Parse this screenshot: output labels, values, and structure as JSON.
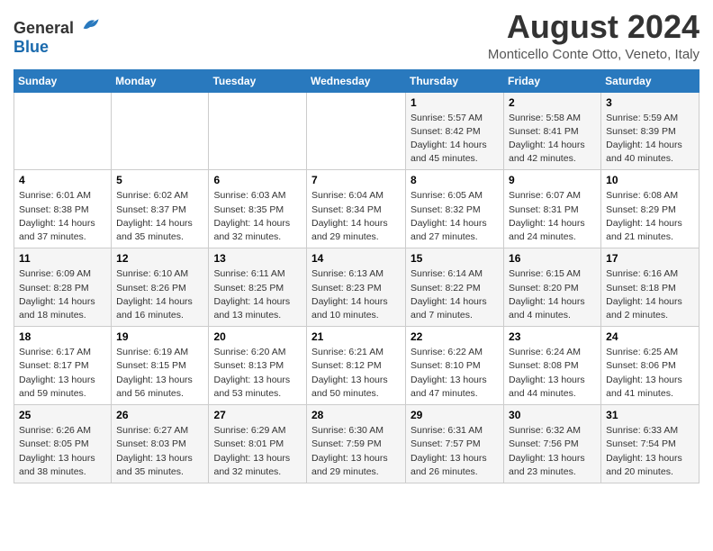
{
  "header": {
    "logo_general": "General",
    "logo_blue": "Blue",
    "month_title": "August 2024",
    "subtitle": "Monticello Conte Otto, Veneto, Italy"
  },
  "days_of_week": [
    "Sunday",
    "Monday",
    "Tuesday",
    "Wednesday",
    "Thursday",
    "Friday",
    "Saturday"
  ],
  "weeks": [
    [
      {
        "day": "",
        "info": ""
      },
      {
        "day": "",
        "info": ""
      },
      {
        "day": "",
        "info": ""
      },
      {
        "day": "",
        "info": ""
      },
      {
        "day": "1",
        "info": "Sunrise: 5:57 AM\nSunset: 8:42 PM\nDaylight: 14 hours\nand 45 minutes."
      },
      {
        "day": "2",
        "info": "Sunrise: 5:58 AM\nSunset: 8:41 PM\nDaylight: 14 hours\nand 42 minutes."
      },
      {
        "day": "3",
        "info": "Sunrise: 5:59 AM\nSunset: 8:39 PM\nDaylight: 14 hours\nand 40 minutes."
      }
    ],
    [
      {
        "day": "4",
        "info": "Sunrise: 6:01 AM\nSunset: 8:38 PM\nDaylight: 14 hours\nand 37 minutes."
      },
      {
        "day": "5",
        "info": "Sunrise: 6:02 AM\nSunset: 8:37 PM\nDaylight: 14 hours\nand 35 minutes."
      },
      {
        "day": "6",
        "info": "Sunrise: 6:03 AM\nSunset: 8:35 PM\nDaylight: 14 hours\nand 32 minutes."
      },
      {
        "day": "7",
        "info": "Sunrise: 6:04 AM\nSunset: 8:34 PM\nDaylight: 14 hours\nand 29 minutes."
      },
      {
        "day": "8",
        "info": "Sunrise: 6:05 AM\nSunset: 8:32 PM\nDaylight: 14 hours\nand 27 minutes."
      },
      {
        "day": "9",
        "info": "Sunrise: 6:07 AM\nSunset: 8:31 PM\nDaylight: 14 hours\nand 24 minutes."
      },
      {
        "day": "10",
        "info": "Sunrise: 6:08 AM\nSunset: 8:29 PM\nDaylight: 14 hours\nand 21 minutes."
      }
    ],
    [
      {
        "day": "11",
        "info": "Sunrise: 6:09 AM\nSunset: 8:28 PM\nDaylight: 14 hours\nand 18 minutes."
      },
      {
        "day": "12",
        "info": "Sunrise: 6:10 AM\nSunset: 8:26 PM\nDaylight: 14 hours\nand 16 minutes."
      },
      {
        "day": "13",
        "info": "Sunrise: 6:11 AM\nSunset: 8:25 PM\nDaylight: 14 hours\nand 13 minutes."
      },
      {
        "day": "14",
        "info": "Sunrise: 6:13 AM\nSunset: 8:23 PM\nDaylight: 14 hours\nand 10 minutes."
      },
      {
        "day": "15",
        "info": "Sunrise: 6:14 AM\nSunset: 8:22 PM\nDaylight: 14 hours\nand 7 minutes."
      },
      {
        "day": "16",
        "info": "Sunrise: 6:15 AM\nSunset: 8:20 PM\nDaylight: 14 hours\nand 4 minutes."
      },
      {
        "day": "17",
        "info": "Sunrise: 6:16 AM\nSunset: 8:18 PM\nDaylight: 14 hours\nand 2 minutes."
      }
    ],
    [
      {
        "day": "18",
        "info": "Sunrise: 6:17 AM\nSunset: 8:17 PM\nDaylight: 13 hours\nand 59 minutes."
      },
      {
        "day": "19",
        "info": "Sunrise: 6:19 AM\nSunset: 8:15 PM\nDaylight: 13 hours\nand 56 minutes."
      },
      {
        "day": "20",
        "info": "Sunrise: 6:20 AM\nSunset: 8:13 PM\nDaylight: 13 hours\nand 53 minutes."
      },
      {
        "day": "21",
        "info": "Sunrise: 6:21 AM\nSunset: 8:12 PM\nDaylight: 13 hours\nand 50 minutes."
      },
      {
        "day": "22",
        "info": "Sunrise: 6:22 AM\nSunset: 8:10 PM\nDaylight: 13 hours\nand 47 minutes."
      },
      {
        "day": "23",
        "info": "Sunrise: 6:24 AM\nSunset: 8:08 PM\nDaylight: 13 hours\nand 44 minutes."
      },
      {
        "day": "24",
        "info": "Sunrise: 6:25 AM\nSunset: 8:06 PM\nDaylight: 13 hours\nand 41 minutes."
      }
    ],
    [
      {
        "day": "25",
        "info": "Sunrise: 6:26 AM\nSunset: 8:05 PM\nDaylight: 13 hours\nand 38 minutes."
      },
      {
        "day": "26",
        "info": "Sunrise: 6:27 AM\nSunset: 8:03 PM\nDaylight: 13 hours\nand 35 minutes."
      },
      {
        "day": "27",
        "info": "Sunrise: 6:29 AM\nSunset: 8:01 PM\nDaylight: 13 hours\nand 32 minutes."
      },
      {
        "day": "28",
        "info": "Sunrise: 6:30 AM\nSunset: 7:59 PM\nDaylight: 13 hours\nand 29 minutes."
      },
      {
        "day": "29",
        "info": "Sunrise: 6:31 AM\nSunset: 7:57 PM\nDaylight: 13 hours\nand 26 minutes."
      },
      {
        "day": "30",
        "info": "Sunrise: 6:32 AM\nSunset: 7:56 PM\nDaylight: 13 hours\nand 23 minutes."
      },
      {
        "day": "31",
        "info": "Sunrise: 6:33 AM\nSunset: 7:54 PM\nDaylight: 13 hours\nand 20 minutes."
      }
    ]
  ]
}
